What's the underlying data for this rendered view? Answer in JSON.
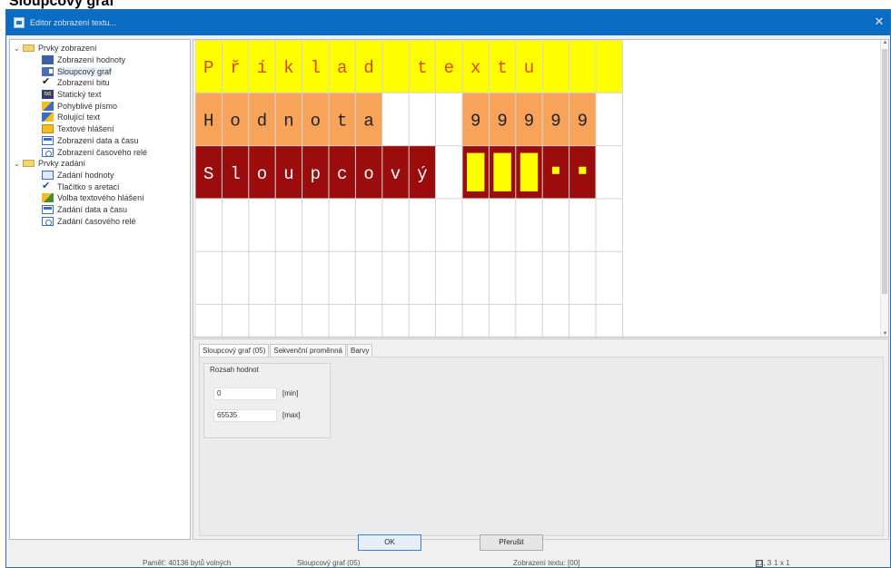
{
  "heading": "Sloupcový graf",
  "window": {
    "title": "Editor zobrazení textu..."
  },
  "tree": {
    "groups": [
      {
        "label": "Prvky zobrazení",
        "icon": "folder-icon",
        "items": [
          {
            "label": "Zobrazení hodnoty",
            "icon": "number-display-icon"
          },
          {
            "label": "Sloupcový graf",
            "icon": "bar-graph-icon",
            "selected": true
          },
          {
            "label": "Zobrazení bitu",
            "icon": "check-icon"
          },
          {
            "label": "Statický text",
            "icon": "static-text-icon"
          },
          {
            "label": "Pohyblivé písmo",
            "icon": "moving-text-icon"
          },
          {
            "label": "Rolující text",
            "icon": "rolling-text-icon"
          },
          {
            "label": "Textové hlášení",
            "icon": "text-message-icon"
          },
          {
            "label": "Zobrazení data a času",
            "icon": "date-time-icon"
          },
          {
            "label": "Zobrazení časového relé",
            "icon": "timer-relay-icon"
          }
        ]
      },
      {
        "label": "Prvky zadání",
        "icon": "folder-icon",
        "items": [
          {
            "label": "Zadání hodnoty",
            "icon": "value-input-icon"
          },
          {
            "label": "Tlačítko s aretací",
            "icon": "latch-button-icon"
          },
          {
            "label": "Volba textového hlášení",
            "icon": "message-choice-icon"
          },
          {
            "label": "Zadání data a času",
            "icon": "date-time-input-icon"
          },
          {
            "label": "Zadání časového relé",
            "icon": "timer-relay-input-icon"
          }
        ]
      }
    ]
  },
  "display": {
    "rows": [
      {
        "chars": [
          "P",
          "ř",
          "í",
          "k",
          "l",
          "a",
          "d",
          " ",
          "t",
          "e",
          "x",
          "t",
          "u",
          "",
          "",
          ""
        ],
        "bg": "#ffff00",
        "color": "#d64a1a",
        "span_cells": 16
      },
      {
        "chars": [
          "H",
          "o",
          "d",
          "n",
          "o",
          "t",
          "a"
        ],
        "bg": "#f7a45a",
        "color": "#222222",
        "span_cells": 7,
        "value": [
          "9",
          "9",
          "9",
          "9",
          "9"
        ],
        "value_bg": "#f7a45a"
      },
      {
        "chars": [
          "S",
          "l",
          "o",
          "u",
          "p",
          "c",
          "o",
          "v",
          "ý"
        ],
        "bg": "#9b0c0c",
        "color": "#ffffff",
        "span_cells": 9,
        "bar_bg": "#9b0c0c",
        "bar_fill": "#ffff00"
      }
    ]
  },
  "properties": {
    "tabs": [
      "Sloupcový graf (05)",
      "Sekvenční proměnná",
      "Barvy"
    ],
    "group_title": "Rozsah hodnot",
    "min_value": "0",
    "min_unit": "[min]",
    "max_value": "65535",
    "max_unit": "[max]"
  },
  "buttons": {
    "ok": "OK",
    "cancel": "Přerušit"
  },
  "status": {
    "memory": "Paměť: 40136 bytů volných",
    "element": "Sloupcový graf (05)",
    "display": "Zobrazení textu: [00]",
    "pos1": "11, 3",
    "pos2": "1 x 1"
  }
}
